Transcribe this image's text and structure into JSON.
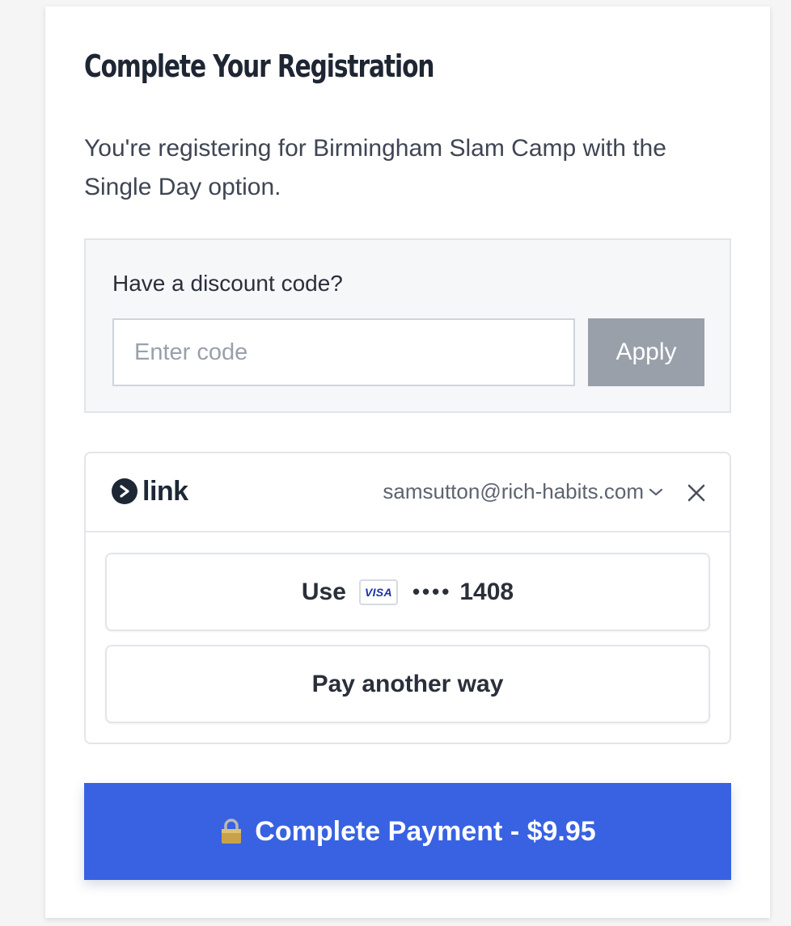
{
  "registration": {
    "title": "Complete Your Registration",
    "description": "You're registering for Birmingham Slam Camp with the Single Day option."
  },
  "discount": {
    "label": "Have a discount code?",
    "placeholder": "Enter code",
    "apply_label": "Apply"
  },
  "link": {
    "logo_text": "link",
    "email": "samsutton@rich-habits.com",
    "use_label": "Use",
    "card_brand": "VISA",
    "card_mask": "••••",
    "card_last4": "1408",
    "pay_another_label": "Pay another way"
  },
  "payment": {
    "complete_label": "Complete Payment - $9.95"
  },
  "colors": {
    "accent": "#3862e2",
    "apply_disabled": "#99a0aa",
    "link_brand": "#1d2735"
  },
  "icons": {
    "logo": "link-logo-icon",
    "chevron": "chevron-down-icon",
    "close": "close-icon",
    "card": "visa-icon",
    "lock": "lock-icon"
  }
}
